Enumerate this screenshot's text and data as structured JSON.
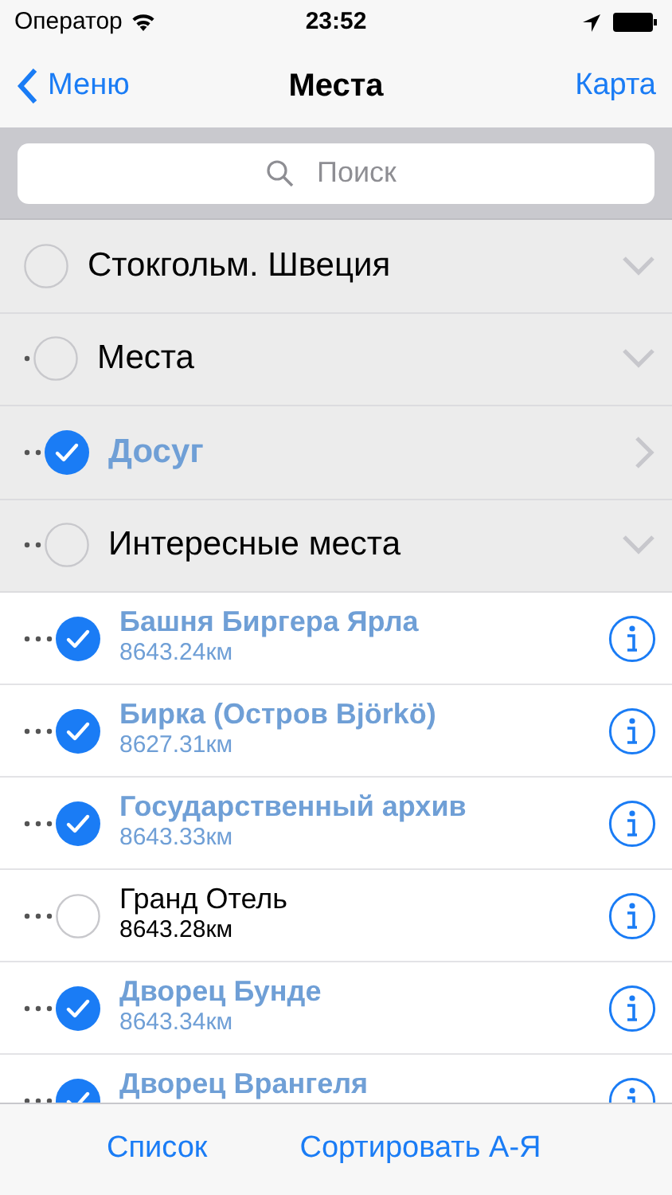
{
  "status_bar": {
    "carrier": "Оператор",
    "time": "23:52"
  },
  "nav_bar": {
    "back": "Меню",
    "title": "Места",
    "action": "Карта"
  },
  "search": {
    "placeholder": "Поиск"
  },
  "categories": [
    {
      "label": "Стокгольм. Швеция",
      "checked": false,
      "expanded": true,
      "children": [
        {
          "label": "Места",
          "checked": false,
          "expanded": true,
          "children": [
            {
              "label": "Досуг",
              "checked": true,
              "expanded": false
            },
            {
              "label": "Интересные места",
              "checked": false,
              "expanded": true,
              "children": [
                {
                  "kind": "place",
                  "label": "Башня Биргера Ярла",
                  "distance": "8643.24км",
                  "checked": true
                },
                {
                  "kind": "place",
                  "label": "Бирка (Остров Björkö)",
                  "distance": "8627.31км",
                  "checked": true
                },
                {
                  "kind": "place",
                  "label": "Государственный архив",
                  "distance": "8643.33км",
                  "checked": true
                },
                {
                  "kind": "place",
                  "label": "Гранд Отель",
                  "distance": "8643.28км",
                  "checked": false
                },
                {
                  "kind": "place",
                  "label": "Дворец Бунде",
                  "distance": "8643.34км",
                  "checked": true
                },
                {
                  "kind": "place",
                  "label": "Дворец Врангеля",
                  "checked": true
                }
              ]
            }
          ]
        }
      ]
    }
  ],
  "toolbar": [
    "Список",
    "Сортировать А-Я"
  ]
}
